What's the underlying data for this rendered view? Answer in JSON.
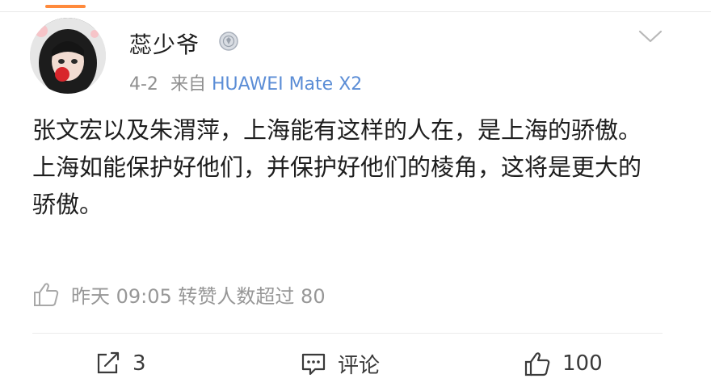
{
  "post": {
    "username": "蕊少爷",
    "date": "4-2",
    "source_prefix": "来自",
    "source_device": "HUAWEI Mate X2",
    "content_lines": [
      "张文宏以及朱渭萍，上海能有这样的人在，是上海的骄傲。",
      "上海如能保护好他们，并保护好他们的棱角，这将是更大的骄傲。"
    ],
    "like_info": "昨天 09:05 转赞人数超过 80"
  },
  "actions": {
    "repost_count": "3",
    "comment_label": "评论",
    "like_count": "100"
  },
  "icons": {
    "avatar": "avatar-image",
    "badge": "medal-badge-icon",
    "more": "chevron-down-icon",
    "thumb": "thumbs-up-icon",
    "repost": "repost-icon",
    "comment": "comment-icon",
    "like": "thumbs-up-icon"
  },
  "colors": {
    "accent": "#ff8a3c",
    "source_link": "#5b8dd6",
    "muted": "#8f8f8f"
  }
}
